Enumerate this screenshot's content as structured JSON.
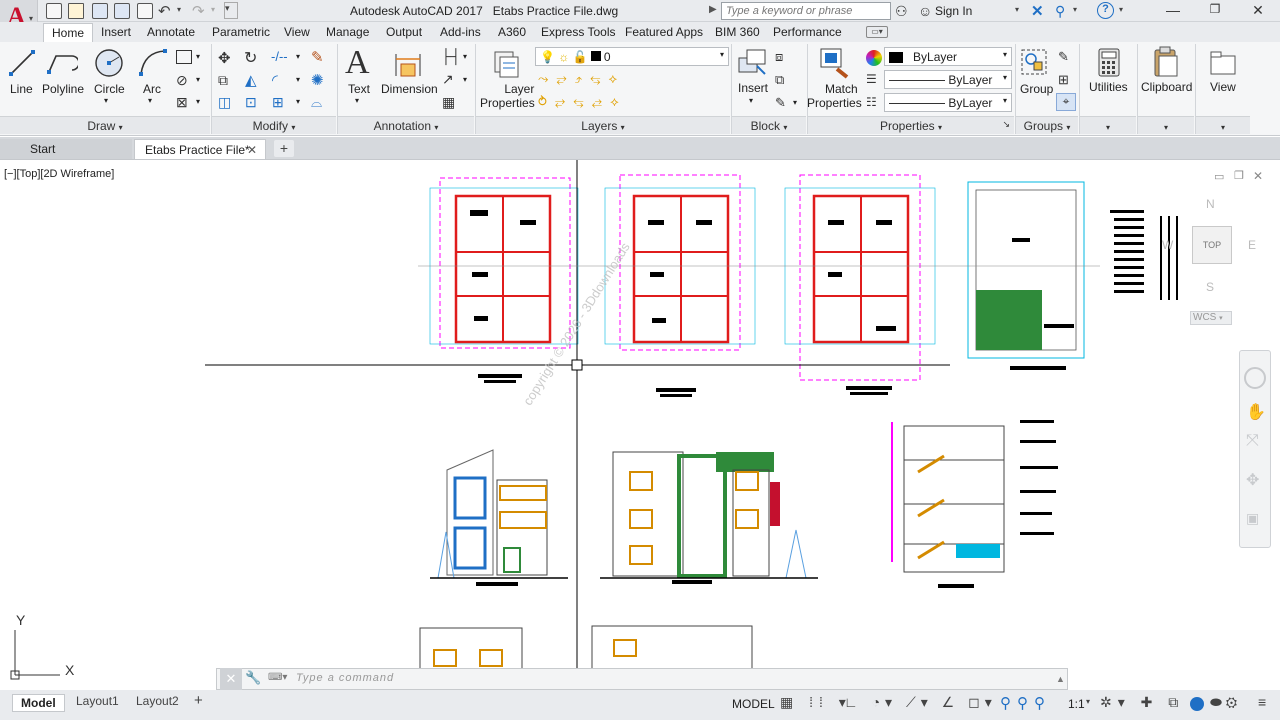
{
  "titlebar": {
    "app_title": "Autodesk AutoCAD 2017",
    "file_title": "Etabs Practice File.dwg",
    "search_placeholder": "Type a keyword or phrase",
    "signin_label": "Sign In",
    "help_label": "?"
  },
  "ribbon_tabs": [
    "Home",
    "Insert",
    "Annotate",
    "Parametric",
    "View",
    "Manage",
    "Output",
    "Add-ins",
    "A360",
    "Express Tools",
    "Featured Apps",
    "BIM 360",
    "Performance"
  ],
  "draw": {
    "line": "Line",
    "polyline": "Polyline",
    "circle": "Circle",
    "arc": "Arc",
    "panel": "Draw"
  },
  "modify": {
    "panel": "Modify"
  },
  "annotation": {
    "text": "Text",
    "dimension": "Dimension",
    "panel": "Annotation"
  },
  "layers": {
    "layer_properties_line1": "Layer",
    "layer_properties_line2": "Properties",
    "current_layer": "0",
    "panel": "Layers"
  },
  "block": {
    "insert": "Insert",
    "panel": "Block"
  },
  "properties": {
    "match_line1": "Match",
    "match_line2": "Properties",
    "color": "ByLayer",
    "linetype": "ByLayer",
    "lineweight": "ByLayer",
    "panel": "Properties"
  },
  "groups": {
    "group": "Group",
    "panel": "Groups"
  },
  "utilities": {
    "label": "Utilities"
  },
  "clipboard": {
    "label": "Clipboard"
  },
  "view": {
    "label": "View"
  },
  "file_tabs": {
    "start": "Start",
    "active": "Etabs Practice File*"
  },
  "viewport": {
    "label": "[−][Top][2D Wireframe]"
  },
  "viewcube": {
    "north": "N",
    "south": "S",
    "east": "E",
    "west": "W",
    "top": "TOP",
    "wcs": "WCS"
  },
  "ucs": {
    "x": "X",
    "y": "Y"
  },
  "watermark": "copyright © 2026 - 3Ddownloads",
  "command": {
    "placeholder": "Type a command"
  },
  "layout_tabs": [
    "Model",
    "Layout1",
    "Layout2"
  ],
  "status": {
    "model": "MODEL",
    "scale": "1:1"
  },
  "colors": {
    "accent": "#1f6fc5",
    "magenta": "#ff00ff",
    "red": "#e01c1c",
    "cyan": "#00b7e0",
    "green": "#2f8a3a"
  }
}
